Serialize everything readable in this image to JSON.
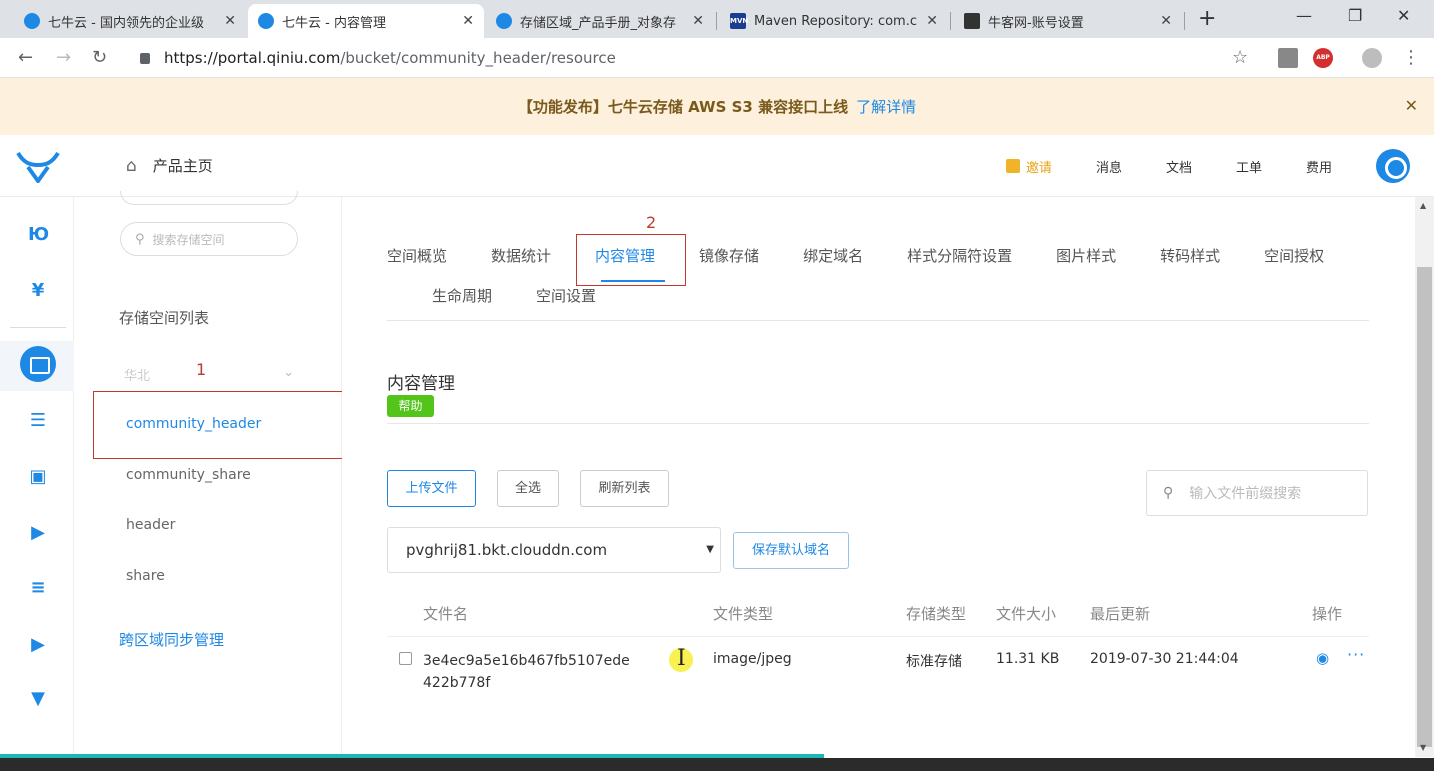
{
  "browser": {
    "tabs": [
      {
        "title": "七牛云 - 国内领先的企业级",
        "icon": "qiniu-favicon"
      },
      {
        "title": "七牛云 - 内容管理",
        "icon": "qiniu-favicon"
      },
      {
        "title": "存储区域_产品手册_对象存",
        "icon": "qiniu-favicon"
      },
      {
        "title": "Maven Repository: com.c",
        "icon": "mvn-favicon"
      },
      {
        "title": "牛客网-账号设置",
        "icon": "nowcoder-favicon"
      }
    ],
    "url_host": "https://portal.qiniu.com",
    "url_path": "/bucket/community_header/resource",
    "ext_label": "ABP"
  },
  "banner": {
    "text": "【功能发布】七牛云存储 AWS S3 兼容接口上线",
    "link": "了解详情"
  },
  "topnav": {
    "home": "产品主页",
    "invite": "邀请",
    "messages": "消息",
    "docs": "文档",
    "tickets": "工单",
    "billing": "费用"
  },
  "sidebar": {
    "search_placeholder": "搜索存储空间",
    "list_title": "存储空间列表",
    "region": "华北",
    "buckets": [
      "community_header",
      "community_share",
      "header",
      "share"
    ],
    "sync": "跨区域同步管理"
  },
  "annotations": {
    "one": "1",
    "two": "2"
  },
  "tabs": {
    "row1": [
      "空间概览",
      "数据统计",
      "内容管理",
      "镜像存储",
      "绑定域名",
      "样式分隔符设置",
      "图片样式",
      "转码样式",
      "空间授权"
    ],
    "row2": [
      "生命周期",
      "空间设置"
    ]
  },
  "content": {
    "title": "内容管理",
    "help": "帮助",
    "upload": "上传文件",
    "select_all": "全选",
    "refresh": "刷新列表",
    "search_placeholder": "输入文件前缀搜索",
    "domain": "pvghrij81.bkt.clouddn.com",
    "save_domain": "保存默认域名"
  },
  "table": {
    "headers": {
      "name": "文件名",
      "type": "文件类型",
      "storage": "存储类型",
      "size": "文件大小",
      "updated": "最后更新",
      "actions": "操作"
    },
    "rows": [
      {
        "name": "3e4ec9a5e16b467fb5107ede422b778f",
        "type": "image/jpeg",
        "storage": "标准存储",
        "size": "11.31 KB",
        "updated": "2019-07-30 21:44:04"
      }
    ]
  },
  "colors": {
    "accent": "#1e88e5",
    "help_badge": "#52c41a",
    "annotation": "#c0392b",
    "banner_bg": "#fdf1dd"
  }
}
